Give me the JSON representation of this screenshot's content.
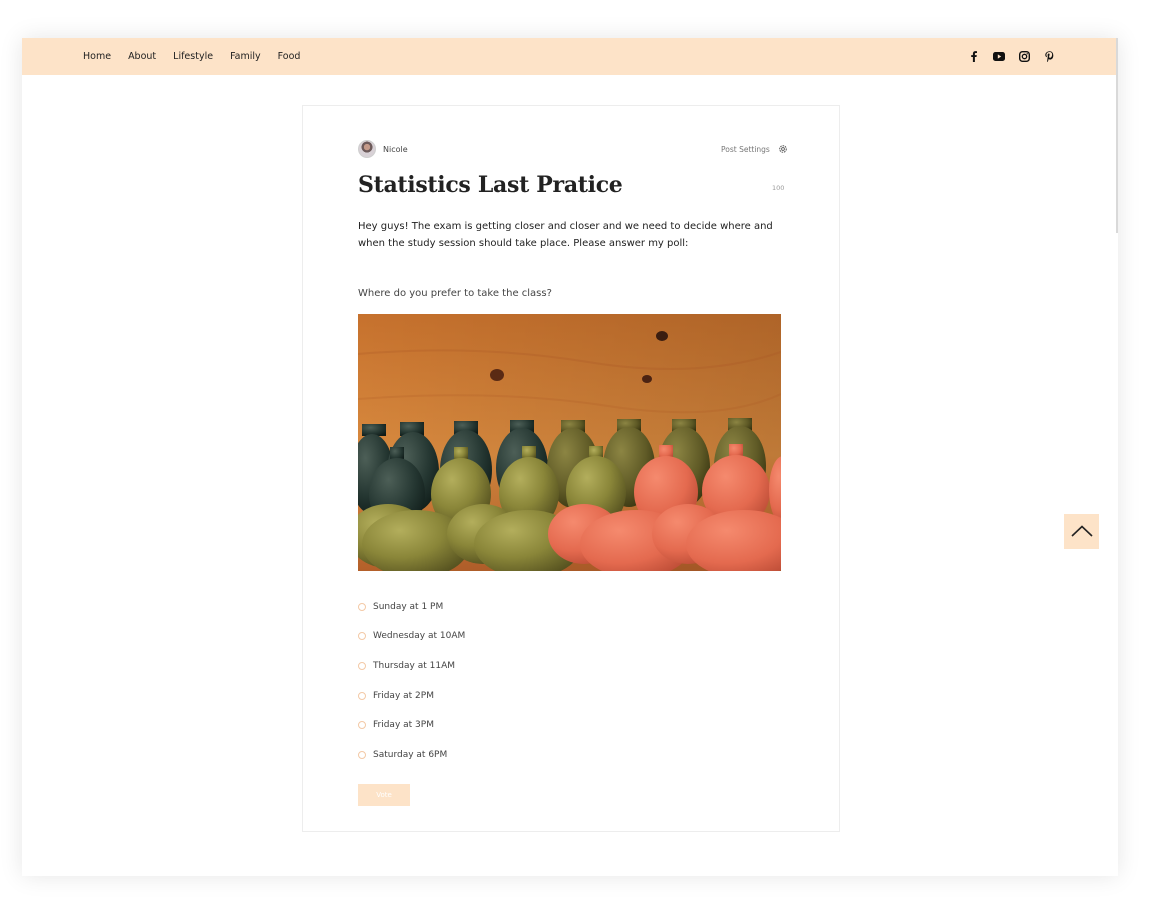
{
  "nav": {
    "items": [
      {
        "label": "Home"
      },
      {
        "label": "About"
      },
      {
        "label": "Lifestyle"
      },
      {
        "label": "Family"
      },
      {
        "label": "Food"
      }
    ]
  },
  "social": {
    "icons": [
      "facebook-icon",
      "youtube-icon",
      "instagram-icon",
      "pinterest-icon"
    ]
  },
  "post": {
    "author": "Nicole",
    "settings_label": "Post Settings",
    "title": "Statistics Last Pratice",
    "char_count": "100",
    "intro": "Hey guys! The exam is getting closer and closer and we need to decide where and when the study session should take place. Please answer my poll:"
  },
  "poll": {
    "question": "Where do you prefer to take the class?",
    "options": [
      {
        "label": "Sunday at 1 PM"
      },
      {
        "label": "Wednesday at 10AM"
      },
      {
        "label": "Thursday at 11AM"
      },
      {
        "label": "Friday at 2PM"
      },
      {
        "label": "Friday at 3PM"
      },
      {
        "label": "Saturday at 6PM"
      }
    ],
    "vote_label": "Vote"
  },
  "colors": {
    "accent": "#fde3c8",
    "radio_border": "#f3c9a6",
    "text": "#222222"
  }
}
